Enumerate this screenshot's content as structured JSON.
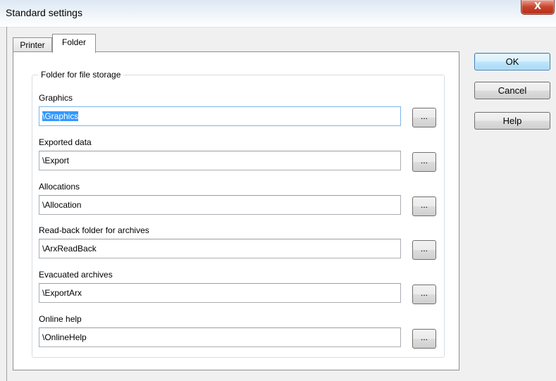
{
  "window": {
    "title": "Standard settings",
    "close_glyph": "X"
  },
  "tabs": [
    {
      "label": "Printer",
      "selected": false
    },
    {
      "label": "Folder",
      "selected": true
    }
  ],
  "group": {
    "legend": "Folder for file storage"
  },
  "fields": [
    {
      "label": "Graphics",
      "value": "\\Graphics",
      "browse": "..."
    },
    {
      "label": "Exported data",
      "value": "\\Export",
      "browse": "..."
    },
    {
      "label": "Allocations",
      "value": "\\Allocation",
      "browse": "..."
    },
    {
      "label": "Read-back folder for archives",
      "value": "\\ArxReadBack",
      "browse": "..."
    },
    {
      "label": "Evacuated archives",
      "value": "\\ExportArx",
      "browse": "..."
    },
    {
      "label": "Online help",
      "value": "\\OnlineHelp",
      "browse": "..."
    }
  ],
  "buttons": {
    "ok": "OK",
    "cancel": "Cancel",
    "help": "Help"
  }
}
